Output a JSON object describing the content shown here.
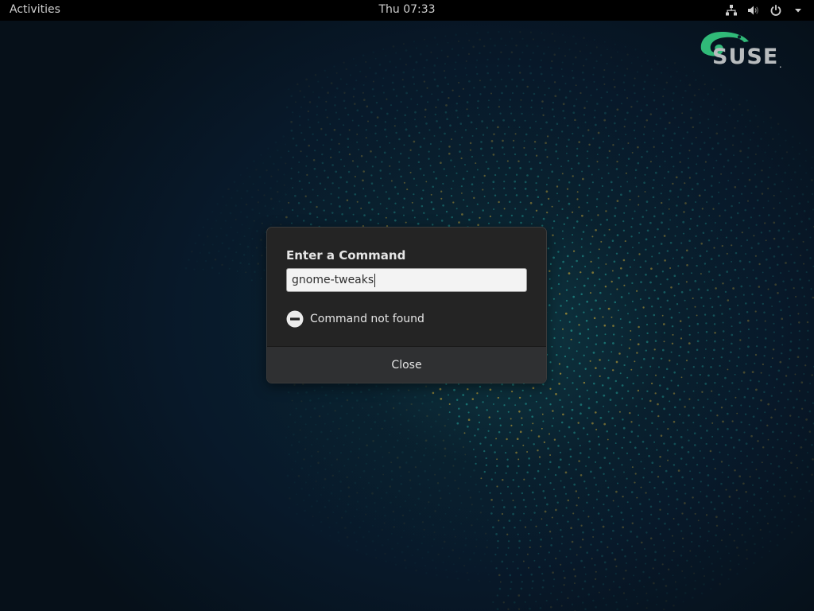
{
  "top_bar": {
    "activities_label": "Activities",
    "clock": "Thu 07:33",
    "icons": [
      "network-wired-icon",
      "volume-icon",
      "power-icon",
      "menu-arrow-icon"
    ]
  },
  "logo": {
    "wordmark": "SUSE",
    "accent_color": "#30ba78"
  },
  "run_dialog": {
    "title": "Enter a Command",
    "command_value": "gnome-tweaks",
    "error_icon": "minus-circle-icon",
    "error_message": "Command not found",
    "close_label": "Close"
  },
  "colors": {
    "topbar_bg": "#000000",
    "dialog_bg": "#242424",
    "dots_teal": "#1f8f8a",
    "dots_gold": "#b59a36"
  }
}
